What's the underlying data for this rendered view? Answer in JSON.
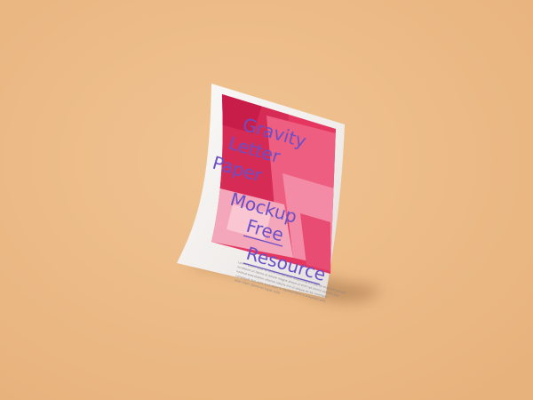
{
  "scene": {
    "background_color": "#ECBB86",
    "paper_color": "#F3F0EE",
    "shadow_color": "#A8764A"
  },
  "poster": {
    "lines": [
      "Gravity",
      "Letter",
      "Paper",
      "Mockup",
      "Free",
      "Resource"
    ],
    "text_color": "#6B4FC8",
    "art_colors": [
      "#E63C68",
      "#F27A98",
      "#D92A55",
      "#F6A2B8",
      "#C81D48"
    ]
  },
  "body_text": {
    "lines": [
      "Lorem ipsum dolor sit amet consectetur adipiscing elit sed do eiusmod tempor",
      "incididunt ut labore et dolore magna aliqua ut enim ad minim veniam quis",
      "nostrud exercitation ullamco laboris nisi ut aliquip ex ea commodo",
      "consequat duis aute irure dolor in reprehenderit in voluptate velit",
      "esse cillum dolore eu fugiat nulla"
    ]
  }
}
